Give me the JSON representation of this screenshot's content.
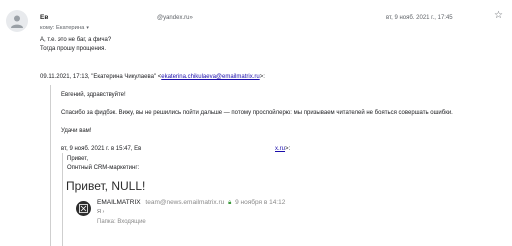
{
  "header": {
    "sender_name": "Ев",
    "sender_email": "@yandex.ru»",
    "date": "вт, 9 нояб. 2021 г., 17:45",
    "to_label": "кому: Екатерина"
  },
  "message": {
    "line1": "А, т.е. это не баг, а фича?",
    "line2": "Тогда прошу прощения."
  },
  "quote": {
    "header_prefix": "09.11.2021, 17:13, \"Екатерина Чикулаева\" <",
    "header_email": "ekaterina.chikulaeva@emailmatrix.ru",
    "header_suffix": ">:",
    "greeting": "Евгений, здравствуйте!",
    "body": "Спасибо за фидбэк. Вижу, вы не решились пойти дальше — потому проспойлерю: мы призываем читателей не бояться совершать ошибки.",
    "signoff": "Удачи вам!",
    "nested_header": "вт, 9 нояб. 2021 г. в 15:47, Ев",
    "nested_link": "x.ru",
    "nested_suffix": ">:",
    "privet": "Привет,",
    "experienced": "Опнтный CRM-маркетинг:"
  },
  "embedded_email": {
    "heading": "Привет, NULL!",
    "sender": "EMAILMATRIX",
    "address": "team@news.emailmatrix.ru",
    "time": "9 ноября в 14:12",
    "to": "Я",
    "folder": "Папка: Входящие"
  },
  "colors": {
    "link": "#1a0dab",
    "lock": "#3c9a3c"
  },
  "icons": {
    "star": "star-icon",
    "avatar": "person-icon",
    "email_avatar": "emailmatrix-logo-icon",
    "lock": "lock-icon",
    "caret": "chevron-down-icon"
  }
}
